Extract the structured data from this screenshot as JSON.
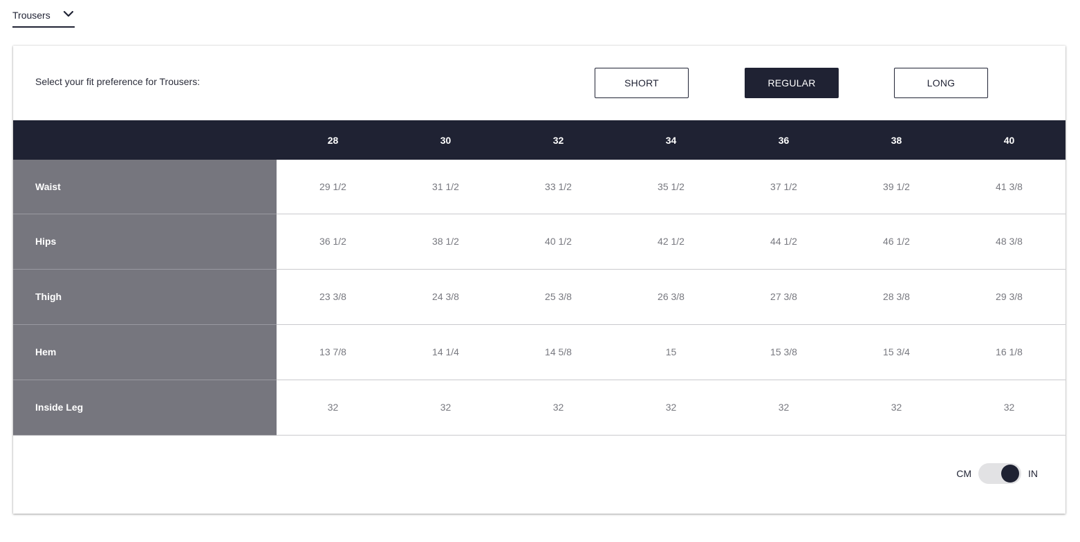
{
  "category": {
    "selected": "Trousers",
    "icon": "chevron-down-icon"
  },
  "fit": {
    "prompt": "Select your fit preference for Trousers:",
    "options": [
      "SHORT",
      "REGULAR",
      "LONG"
    ],
    "selected": "REGULAR"
  },
  "table": {
    "sizes": [
      "28",
      "30",
      "32",
      "34",
      "36",
      "38",
      "40"
    ],
    "rows": [
      {
        "label": "Waist",
        "values": [
          "29 1/2",
          "31 1/2",
          "33 1/2",
          "35 1/2",
          "37 1/2",
          "39 1/2",
          "41 3/8"
        ]
      },
      {
        "label": "Hips",
        "values": [
          "36 1/2",
          "38 1/2",
          "40 1/2",
          "42 1/2",
          "44 1/2",
          "46 1/2",
          "48 3/8"
        ]
      },
      {
        "label": "Thigh",
        "values": [
          "23 3/8",
          "24 3/8",
          "25 3/8",
          "26 3/8",
          "27 3/8",
          "28 3/8",
          "29 3/8"
        ]
      },
      {
        "label": "Hem",
        "values": [
          "13 7/8",
          "14 1/4",
          "14 5/8",
          "15",
          "15 3/8",
          "15 3/4",
          "16 1/8"
        ]
      },
      {
        "label": "Inside Leg",
        "values": [
          "32",
          "32",
          "32",
          "32",
          "32",
          "32",
          "32"
        ]
      }
    ]
  },
  "units": {
    "left": "CM",
    "right": "IN",
    "selected": "IN"
  },
  "colors": {
    "primary": "#1f2233",
    "label_bg": "#76767e",
    "value_text": "#77787f"
  }
}
